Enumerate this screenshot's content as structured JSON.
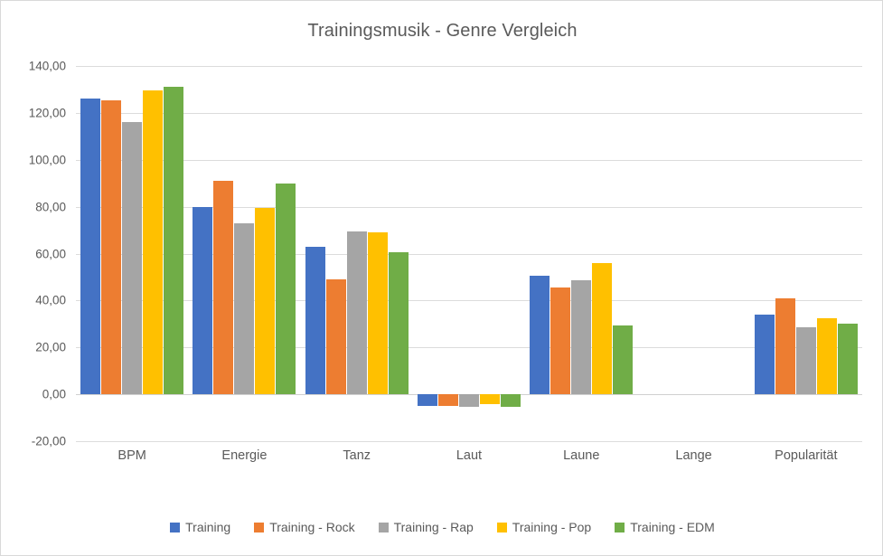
{
  "chart_data": {
    "type": "bar",
    "title": "Trainingsmusik - Genre Vergleich",
    "xlabel": "",
    "ylabel": "",
    "ylim": [
      -20,
      140
    ],
    "ytick_step": 20,
    "ytick_labels": [
      "140,00",
      "120,00",
      "100,00",
      "80,00",
      "60,00",
      "40,00",
      "20,00",
      "0,00",
      "-20,00"
    ],
    "ytick_values": [
      140,
      120,
      100,
      80,
      60,
      40,
      20,
      0,
      -20
    ],
    "grid": true,
    "legend_position": "bottom",
    "categories": [
      "BPM",
      "Energie",
      "Tanz",
      "Laut",
      "Laune",
      "Lange",
      "Popularität"
    ],
    "series": [
      {
        "name": "Training",
        "color": "#4472c4",
        "values": [
          126.2,
          80.0,
          63.0,
          -5.0,
          50.6,
          0,
          33.8
        ]
      },
      {
        "name": "Training - Rock",
        "color": "#ed7d31",
        "values": [
          125.5,
          91.0,
          49.0,
          -5.1,
          45.7,
          0,
          41.0
        ]
      },
      {
        "name": "Training - Rap",
        "color": "#a5a5a5",
        "values": [
          116.0,
          72.8,
          69.4,
          -5.2,
          48.5,
          0,
          28.5
        ]
      },
      {
        "name": "Training - Pop",
        "color": "#ffc000",
        "values": [
          129.5,
          79.4,
          69.0,
          -4.2,
          55.9,
          0,
          32.4
        ]
      },
      {
        "name": "Training - EDM",
        "color": "#70ad47",
        "values": [
          131.0,
          90.0,
          60.6,
          -5.2,
          29.3,
          0,
          30.0
        ]
      }
    ]
  },
  "colors": {
    "title_text": "#5a5a5a",
    "axis_text": "#5a5a5a",
    "gridline": "#dcdcdc",
    "border": "#d9d9d9",
    "background": "#ffffff"
  }
}
